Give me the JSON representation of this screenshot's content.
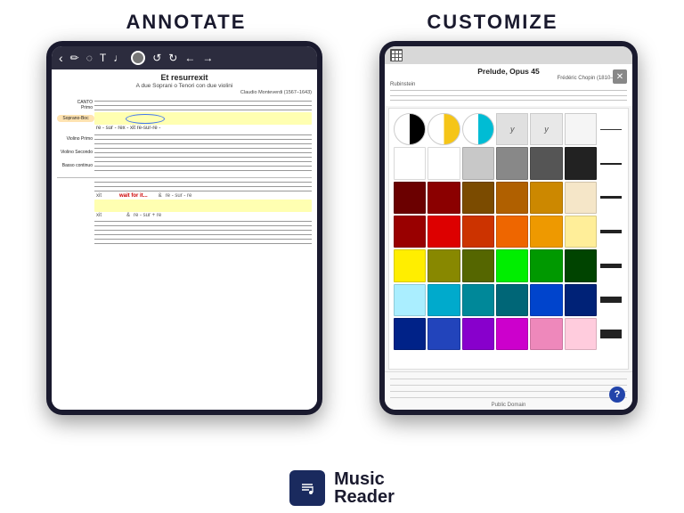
{
  "header": {
    "annotate_label": "ANNOTATE",
    "customize_label": "CUSTOMIZE"
  },
  "left_tablet": {
    "score": {
      "title": "Et resurrexit",
      "subtitle": "A due Soprani o Tenori con due violini",
      "composer": "Claudio Monteverdi (1567–1643)",
      "parts": [
        {
          "label": "CANTO Primo",
          "highlighted": false
        },
        {
          "label": "Soprano-Boc",
          "highlighted": true,
          "annotated": true
        },
        {
          "label": "Violino Primo",
          "highlighted": false
        },
        {
          "label": "Violino Secondo",
          "highlighted": false
        },
        {
          "label": "Basso continuo",
          "highlighted": false
        }
      ],
      "lyrics": "re - sur - rex - xit    re-sur-re -",
      "wait_text": "wait for it...",
      "bottom_lyrics": "xit    &  re - sur - re"
    }
  },
  "right_tablet": {
    "score": {
      "title": "Prelude, Opus 45",
      "composer": "Frédéric Chopin (1810–1849)",
      "instrument": "Rubinstein"
    },
    "color_picker": {
      "row1": [
        "half-black",
        "half-yellow",
        "half-cyan",
        "y-symbol",
        "y-symbol2",
        "blank",
        "line-thin"
      ],
      "row2": [
        "white",
        "white2",
        "gray-light",
        "gray",
        "gray-dark",
        "black-dark",
        "line-med"
      ],
      "row3": [
        "dark-red",
        "red-dark2",
        "brown",
        "orange-brown",
        "orange",
        "cream",
        "line-thick"
      ],
      "row4": [
        "dark-red2",
        "red",
        "red-orange",
        "orange2",
        "yellow-orange",
        "yellow-light",
        "line-thicker"
      ],
      "row5": [
        "yellow",
        "olive",
        "olive-dark",
        "green-bright",
        "green",
        "green-dark",
        "line-thickest"
      ],
      "row6": [
        "cyan-light",
        "cyan",
        "teal",
        "teal-dark",
        "blue",
        "blue-dark",
        "line-solid"
      ],
      "row7": [
        "navy",
        "blue-med",
        "purple",
        "magenta",
        "pink",
        "pink-light",
        "line-block"
      ]
    },
    "help_label": "?",
    "public_domain": "Public Domain"
  },
  "footer": {
    "logo_icon": "♪",
    "logo_music": "Music",
    "logo_reader": "Reader"
  },
  "colors": {
    "row1": [
      "#808080",
      "#f5c518",
      "#00bcd4",
      "#e0e0e0",
      "#e0e0e0",
      "#f5f5f5"
    ],
    "row2": [
      "#ffffff",
      "#ffffff",
      "#c8c8c8",
      "#888888",
      "#555555",
      "#222222"
    ],
    "row3": [
      "#6b0000",
      "#8b0000",
      "#7b4b00",
      "#b06000",
      "#cc8800",
      "#f5e6c8"
    ],
    "row4": [
      "#990000",
      "#dd0000",
      "#cc3300",
      "#ee6600",
      "#ee9900",
      "#ffee99"
    ],
    "row5": [
      "#ffee00",
      "#888800",
      "#556600",
      "#00ee00",
      "#009900",
      "#004400"
    ],
    "row6": [
      "#aaeeff",
      "#00aacc",
      "#008899",
      "#006677",
      "#0044cc",
      "#002277"
    ],
    "row7": [
      "#002288",
      "#2244bb",
      "#8800cc",
      "#cc00cc",
      "#ee88bb",
      "#ffccdd"
    ]
  }
}
